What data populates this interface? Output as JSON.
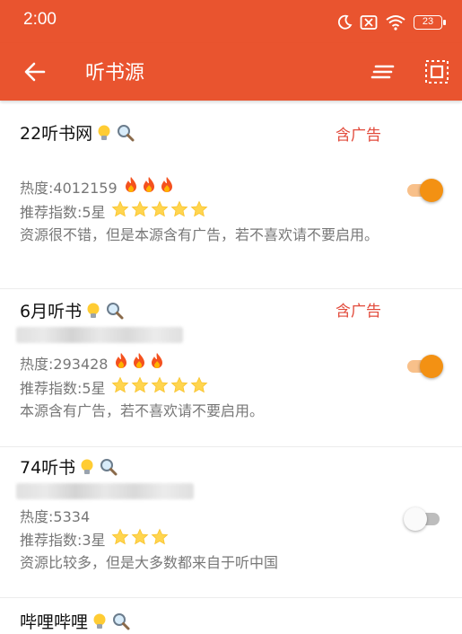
{
  "status_bar": {
    "time": "2:00",
    "battery": "23",
    "icons": [
      "moon-icon",
      "no-sim-icon",
      "wifi-icon",
      "battery-icon"
    ]
  },
  "app_bar": {
    "title": "听书源",
    "background": "#E9542F"
  },
  "labels": {
    "heat_prefix": "热度: ",
    "rating_prefix": "推荐指数:"
  },
  "sources": [
    {
      "name": "22听书网",
      "ad_tag": "含广告",
      "url_hidden": false,
      "heat": "4012159",
      "flames": 3,
      "rating_text": "5星",
      "stars": 5,
      "description": "资源很不错，但是本源含有广告，若不喜欢请不要启用。",
      "enabled": true
    },
    {
      "name": "6月听书",
      "ad_tag": "含广告",
      "url_hidden": true,
      "heat": "293428",
      "flames": 3,
      "rating_text": "5星",
      "stars": 5,
      "description": "本源含有广告，若不喜欢请不要启用。",
      "enabled": true
    },
    {
      "name": "74听书",
      "ad_tag": "",
      "url_hidden": true,
      "heat": "5334",
      "flames": 0,
      "rating_text": "3星",
      "stars": 3,
      "description": "资源比较多，但是大多数都来自于听中国",
      "enabled": false
    },
    {
      "name": "哔哩哔哩",
      "ad_tag": "",
      "url_hidden": false,
      "heat": "",
      "flames": 0,
      "rating_text": "",
      "stars": 0,
      "description": "",
      "enabled": false
    }
  ],
  "colors": {
    "accent": "#F39113",
    "ad_tag": "#E24A3B",
    "toggle_track_on": "#F8C08A"
  }
}
